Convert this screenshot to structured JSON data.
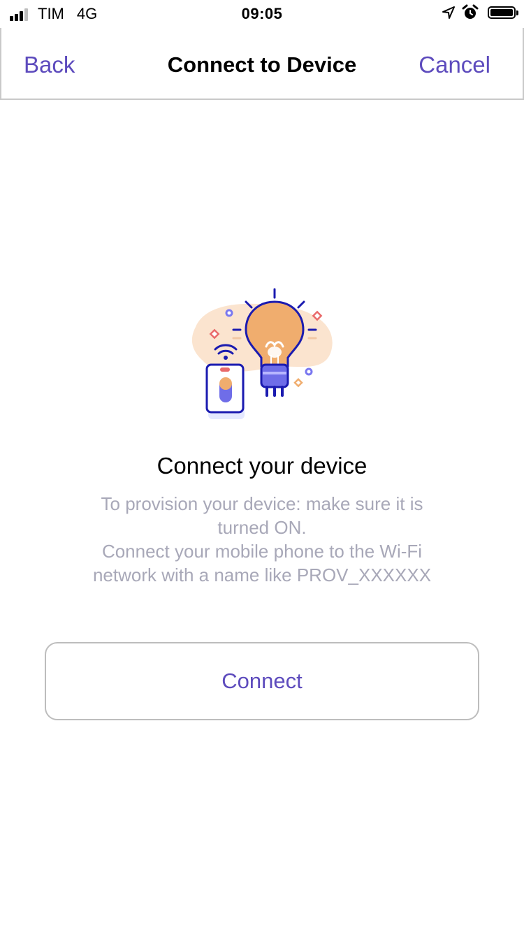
{
  "status_bar": {
    "carrier": "TIM",
    "network": "4G",
    "time": "09:05"
  },
  "nav": {
    "back_label": "Back",
    "title": "Connect to Device",
    "cancel_label": "Cancel"
  },
  "main": {
    "heading": "Connect your device",
    "description_lines": [
      "To provision your device: make sure it is",
      "turned ON.",
      "Connect your mobile phone to the Wi-Fi",
      "network with a name like PROV_XXXXXX"
    ],
    "connect_label": "Connect"
  },
  "colors": {
    "accent": "#5d4bbd",
    "muted_text": "#a8a8b8",
    "bulb_orange": "#f0ad6e",
    "icon_blue": "#1b1bb0"
  },
  "icons": [
    "signal-icon",
    "location-arrow-icon",
    "alarm-clock-icon",
    "battery-icon",
    "lightbulb-phone-illustration"
  ]
}
